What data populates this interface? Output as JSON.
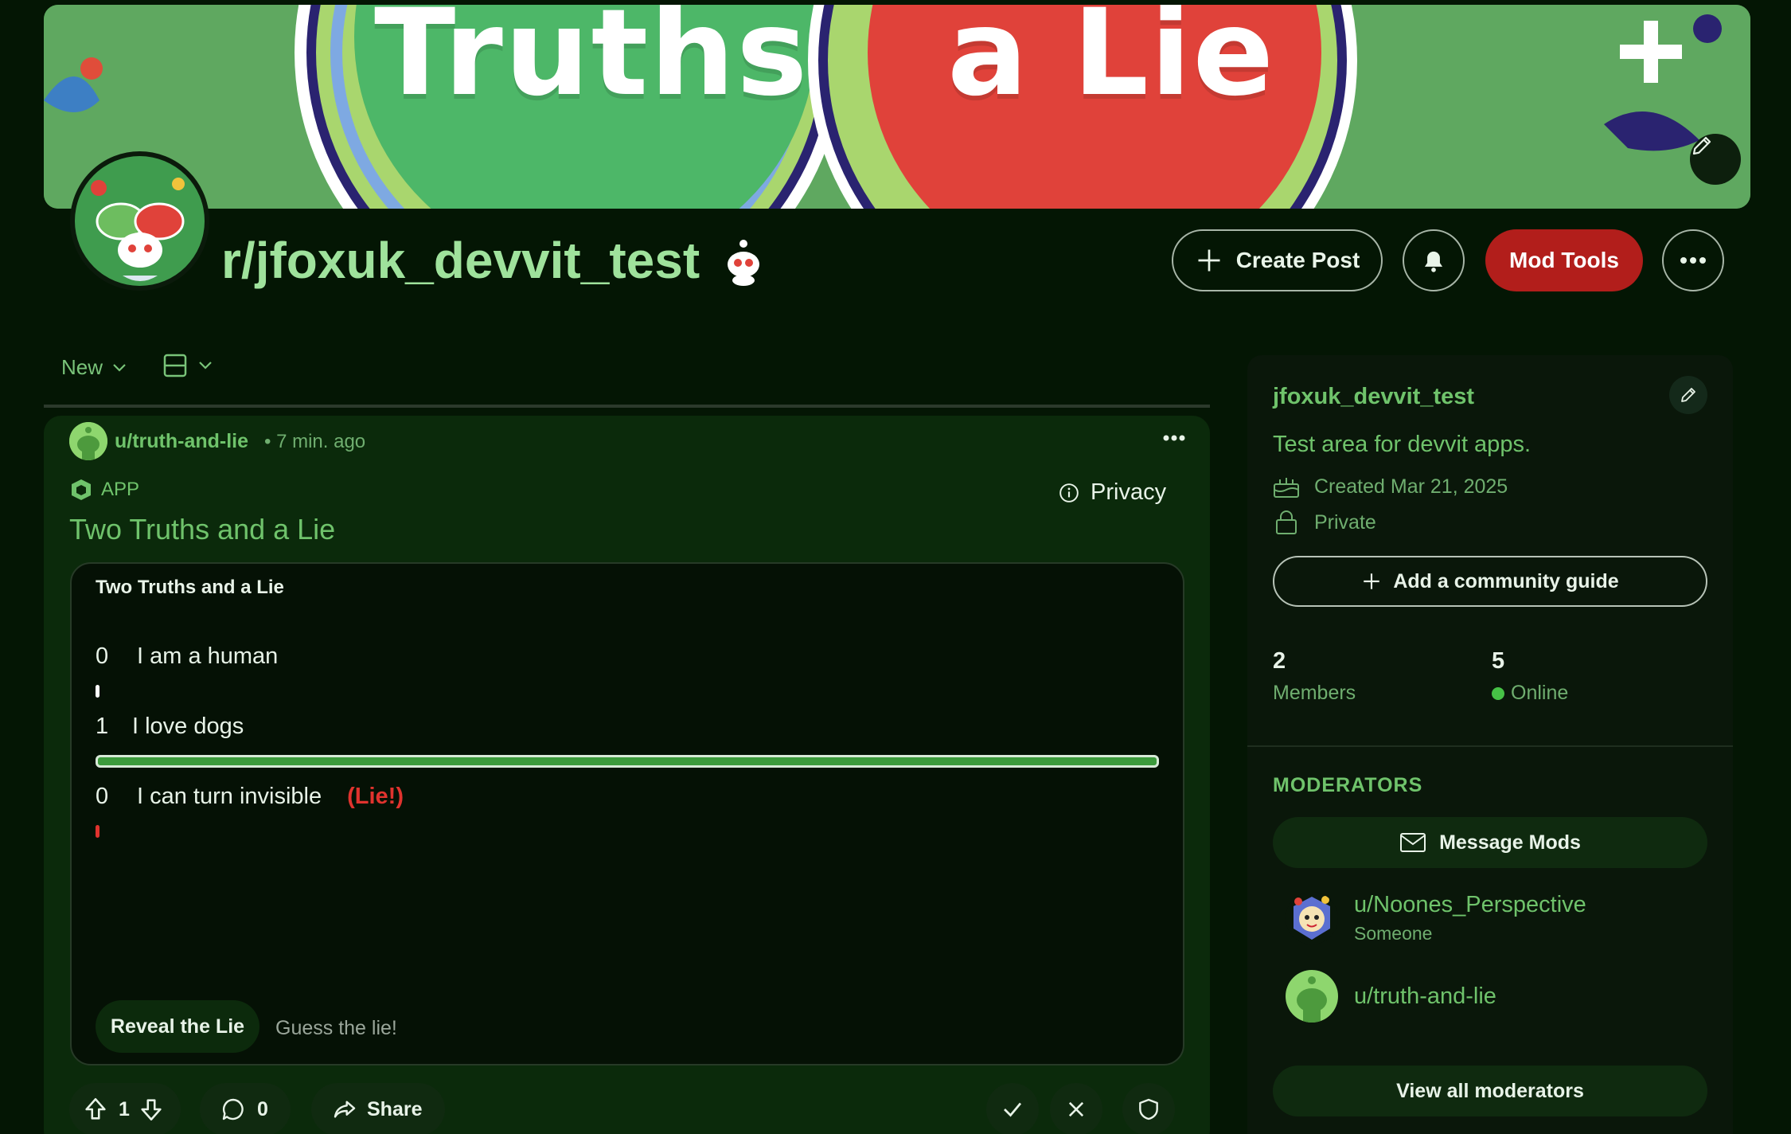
{
  "banner": {
    "text_left": "Truths",
    "text_right": "a Lie"
  },
  "community": {
    "title": "r/jfoxuk_devvit_test",
    "create_post_label": "Create Post",
    "mod_tools_label": "Mod Tools"
  },
  "feed": {
    "sort_label": "New"
  },
  "post": {
    "author": "u/truth-and-lie",
    "time": "• 7 min. ago",
    "tag": "APP",
    "privacy_label": "Privacy",
    "title": "Two Truths and a Lie",
    "app": {
      "header": "Two Truths and a Lie",
      "statements": [
        {
          "count": "0",
          "text": "I am a human",
          "is_lie": false,
          "vote_fraction": 0.0
        },
        {
          "count": "1",
          "text": "I love dogs",
          "is_lie": false,
          "vote_fraction": 1.0
        },
        {
          "count": "0",
          "text": "I can turn invisible",
          "is_lie": true,
          "lie_label": "(Lie!)",
          "vote_fraction": 0.0
        }
      ],
      "reveal_label": "Reveal the Lie",
      "guess_label": "Guess the lie!"
    },
    "votes": "1",
    "comments": "0",
    "share_label": "Share"
  },
  "sidebar": {
    "name": "jfoxuk_devvit_test",
    "description": "Test area for devvit apps.",
    "created": "Created Mar 21, 2025",
    "visibility": "Private",
    "guide_label": "Add a community guide",
    "members_count": "2",
    "members_label": "Members",
    "online_count": "5",
    "online_label": "Online",
    "moderators_heading": "MODERATORS",
    "message_mods_label": "Message Mods",
    "moderators": [
      {
        "name": "u/Noones_Perspective",
        "flair": "Someone"
      },
      {
        "name": "u/truth-and-lie",
        "flair": ""
      }
    ],
    "view_all_label": "View all moderators"
  },
  "colors": {
    "background": "#041604",
    "accent_green": "#6fc36b",
    "mod_tools_red": "#b21e1b",
    "lie_red": "#e0332e",
    "bar_green": "#3c9a3c"
  },
  "icons": [
    "pencil-icon",
    "plus-icon",
    "bell-icon",
    "more-icon",
    "chevron-down-icon",
    "layout-icon",
    "app-icon",
    "info-icon",
    "upvote-icon",
    "downvote-icon",
    "comment-icon",
    "share-icon",
    "approve-icon",
    "remove-icon",
    "shield-icon",
    "cake-icon",
    "lock-icon",
    "mail-icon"
  ]
}
